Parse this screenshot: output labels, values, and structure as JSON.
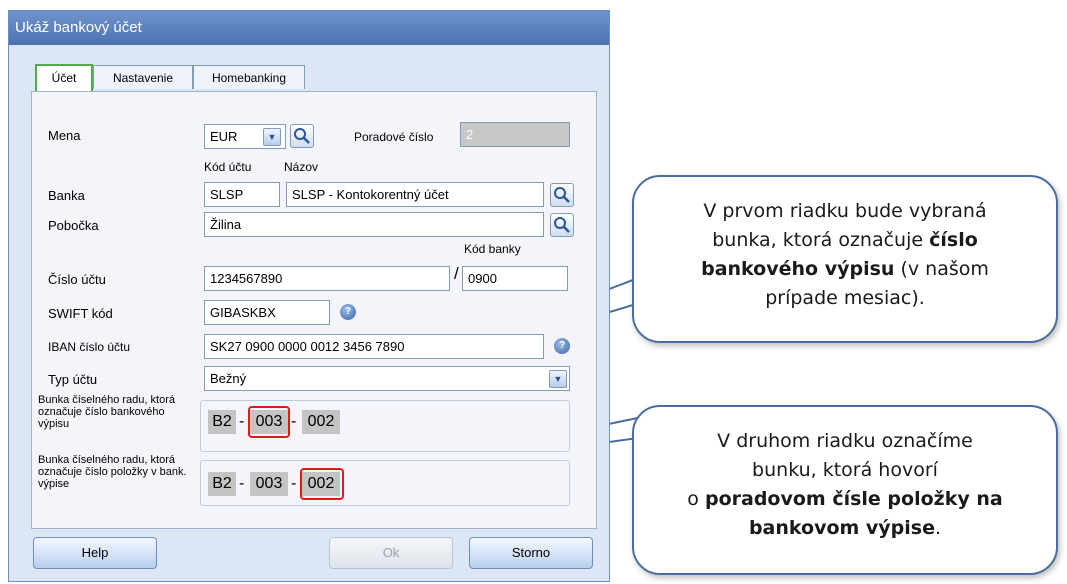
{
  "window": {
    "title": "Ukáž bankový účet"
  },
  "tabs": [
    {
      "label": "Účet",
      "active": true
    },
    {
      "label": "Nastavenie",
      "active": false
    },
    {
      "label": "Homebanking",
      "active": false
    }
  ],
  "form": {
    "mena_label": "Mena",
    "mena_value": "EUR",
    "poradove_label": "Poradové číslo",
    "poradove_value": "2",
    "kod_uctu_header": "Kód účtu",
    "nazov_header": "Názov",
    "banka_label": "Banka",
    "banka_code": "SLSP",
    "banka_name": "SLSP - Kontokorentný účet",
    "pobocka_label": "Pobočka",
    "pobocka_value": "Žilina",
    "kod_banky_header": "Kód banky",
    "cislo_uctu_label": "Číslo účtu",
    "cislo_uctu_value": "1234567890",
    "slash": "/",
    "kod_banky_value": "0900",
    "swift_label": "SWIFT kód",
    "swift_value": "GIBASKBX",
    "iban_label": "IBAN číslo účtu",
    "iban_value": "SK27 0900 0000 0012 3456 7890",
    "typ_label": "Typ účtu",
    "typ_value": "Bežný",
    "row1_label": "Bunka číselného radu, ktorá označuje číslo bankového výpisu",
    "row1_cells": [
      "B2",
      "003",
      "002"
    ],
    "row2_label": "Bunka číselného radu, ktorá označuje číslo položky v bank. výpise",
    "row2_cells": [
      "B2",
      "003",
      "002"
    ],
    "dash": "-"
  },
  "buttons": {
    "help": "Help",
    "ok": "Ok",
    "storno": "Storno"
  },
  "callouts": {
    "first": {
      "line1": "V prvom riadku bude vybraná",
      "line2_pre": "bunka, ktorá označuje ",
      "line2_bold": "číslo",
      "line3_bold": "bankového výpisu",
      "line3_post": " (v našom",
      "line4": "prípade mesiac)."
    },
    "second": {
      "line1": "V druhom riadku označíme",
      "line2": "bunku, ktorá hovorí",
      "line3_pre": "o ",
      "line3_bold": "poradovom čísle položky na",
      "line4_bold": "bankovom výpise",
      "line4_post": "."
    }
  },
  "colors": {
    "accent_red": "#e21a1a",
    "callout_border": "#4a6e9b",
    "title_bar": "#5a80bf"
  },
  "icons": [
    "lookup-magnifier-icon",
    "dropdown-arrow-icon",
    "info-icon"
  ]
}
